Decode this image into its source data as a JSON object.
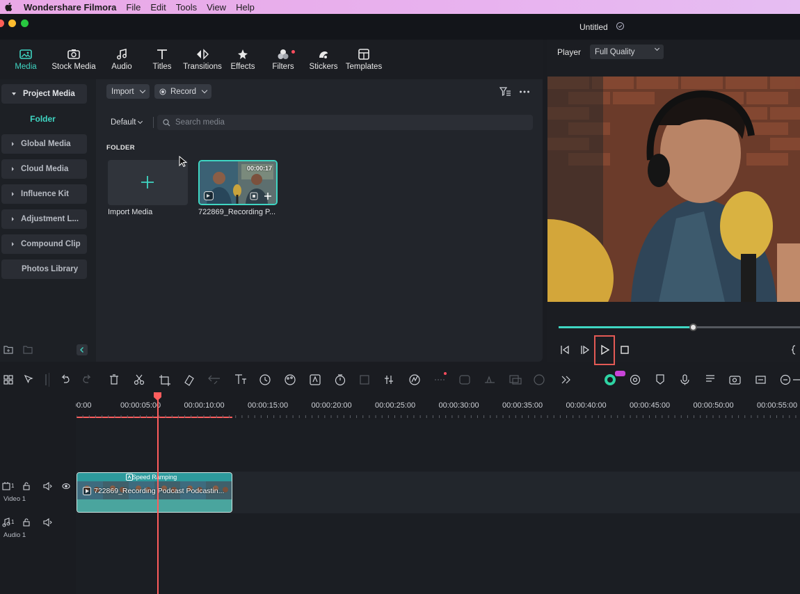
{
  "menubar": {
    "app_name": "Wondershare Filmora",
    "items": [
      "File",
      "Edit",
      "Tools",
      "View",
      "Help"
    ]
  },
  "window": {
    "project_title": "Untitled"
  },
  "tabs": [
    {
      "label": "Media",
      "icon": "media-icon",
      "active": true
    },
    {
      "label": "Stock Media",
      "icon": "stock-media-icon"
    },
    {
      "label": "Audio",
      "icon": "music-note-icon"
    },
    {
      "label": "Titles",
      "icon": "titles-icon"
    },
    {
      "label": "Transitions",
      "icon": "transitions-icon"
    },
    {
      "label": "Effects",
      "icon": "effects-icon"
    },
    {
      "label": "Filters",
      "icon": "filters-icon",
      "notification_dot": true
    },
    {
      "label": "Stickers",
      "icon": "stickers-icon"
    },
    {
      "label": "Templates",
      "icon": "templates-icon"
    }
  ],
  "sidebar": {
    "items": [
      {
        "label": "Project Media",
        "expanded": true
      },
      {
        "label": "Global Media"
      },
      {
        "label": "Cloud Media"
      },
      {
        "label": "Influence Kit"
      },
      {
        "label": "Adjustment L..."
      },
      {
        "label": "Compound Clip"
      },
      {
        "label": "Photos Library"
      }
    ],
    "folder_label": "Folder"
  },
  "media_toolbar": {
    "import_label": "Import",
    "record_label": "Record",
    "sort_label": "Default",
    "search_placeholder": "Search media"
  },
  "media_grid": {
    "section_heading": "FOLDER",
    "import_card_label": "Import Media",
    "clip": {
      "label": "722869_Recording P...",
      "duration": "00:00:17"
    }
  },
  "player": {
    "label": "Player",
    "quality": "Full Quality",
    "progress": 0.56
  },
  "timeline": {
    "tick_labels": [
      "00:00",
      "00:00:05:00",
      "00:00:10:00",
      "00:00:15:00",
      "00:00:20:00",
      "00:00:25:00",
      "00:00:30:00",
      "00:00:35:00",
      "00:00:40:00",
      "00:00:45:00",
      "00:00:50:00",
      "00:00:55:00"
    ],
    "tracks": {
      "video": "Video 1",
      "audio": "Audio 1"
    },
    "clip": {
      "effect_label": "Speed Ramping",
      "name": "722869_Recording Podcast Podcastin..."
    }
  },
  "colors": {
    "accent": "#3fd6c3",
    "playhead": "#ff5d5d",
    "highlight_box": "#e45a55",
    "menubar": "#e9a8e6"
  }
}
